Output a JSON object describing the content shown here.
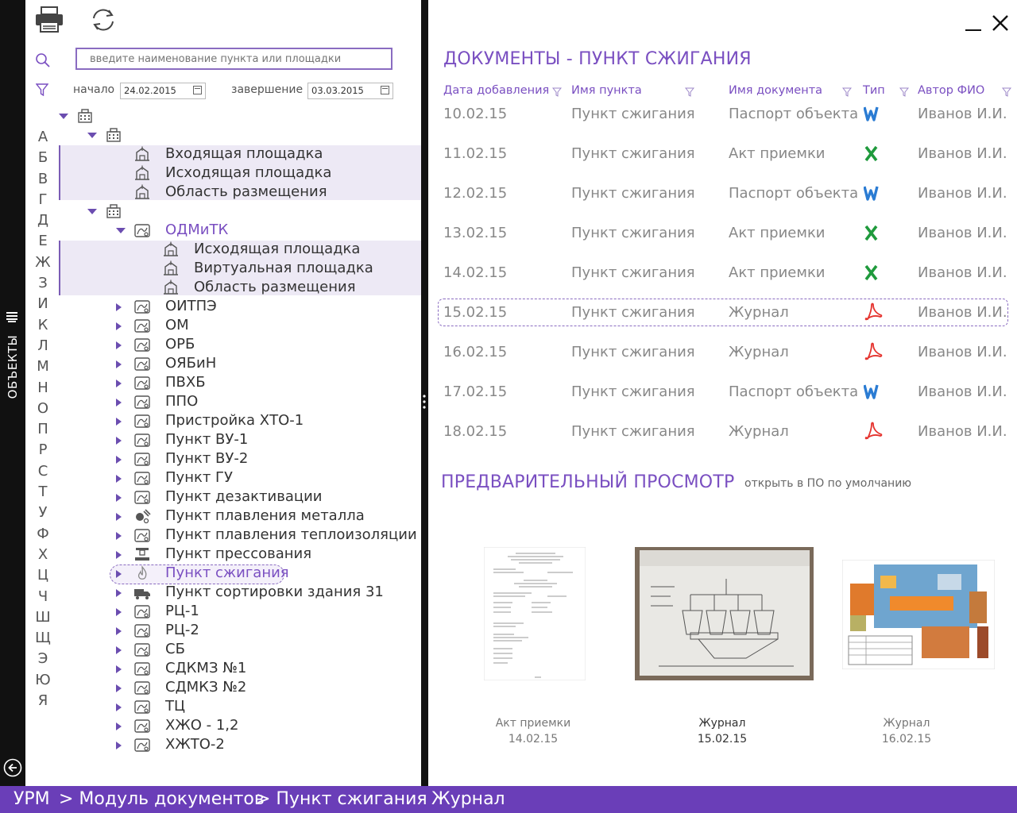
{
  "sidebar": {
    "label": "ОБЪЕКТЫ"
  },
  "search": {
    "placeholder": "введите наименование пункта или площадки"
  },
  "filter": {
    "start_label": "начало",
    "start_value": "24.02.2015",
    "end_label": "завершение",
    "end_value": "03.03.2015"
  },
  "alphabet": [
    "А",
    "Б",
    "В",
    "Г",
    "Д",
    "Е",
    "Ж",
    "З",
    "И",
    "К",
    "Л",
    "М",
    "Н",
    "О",
    "П",
    "Р",
    "С",
    "Т",
    "У",
    "Ф",
    "Х",
    "Ц",
    "Ч",
    "Ш",
    "Щ",
    "Э",
    "Ю",
    "Я"
  ],
  "tree": {
    "group1": [
      "Входящая площадка",
      "Исходящая площадка",
      "Область размещения"
    ],
    "odmitk": "ОДМиТК",
    "group2": [
      "Исходящая площадка",
      "Виртуальная площадка",
      "Область размещения"
    ],
    "items": [
      "ОИТПЭ",
      "ОМ",
      "ОРБ",
      "ОЯБиН",
      "ПВХБ",
      "ППО",
      "Пристройка ХТО-1",
      "Пункт ВУ-1",
      "Пункт ВУ-2",
      "Пункт ГУ",
      "Пункт дезактивации",
      "Пункт плавления металла",
      "Пункт плавления теплоизоляции",
      "Пункт прессования",
      "Пункт сжигания",
      "Пункт сортировки здания 31",
      "РЦ-1",
      "РЦ-2",
      "СБ",
      "СДКМЗ №1",
      "СДМКЗ №2",
      "ТЦ",
      "ХЖО - 1,2",
      "ХЖТО-2"
    ]
  },
  "documents": {
    "title": "ДОКУМЕНТЫ - ПУНКТ СЖИГАНИЯ",
    "columns": [
      "Дата добавления",
      "Имя пункта",
      "Имя документа",
      "Тип",
      "Автор ФИО"
    ],
    "rows": [
      {
        "date": "10.02.15",
        "point": "Пункт сжигания",
        "doc": "Паспорт объекта",
        "type": "word",
        "author": "Иванов И.И."
      },
      {
        "date": "11.02.15",
        "point": "Пункт сжигания",
        "doc": "Акт приемки",
        "type": "excel",
        "author": "Иванов И.И."
      },
      {
        "date": "12.02.15",
        "point": "Пункт сжигания",
        "doc": "Паспорт объекта",
        "type": "word",
        "author": "Иванов И.И."
      },
      {
        "date": "13.02.15",
        "point": "Пункт сжигания",
        "doc": "Акт приемки",
        "type": "excel",
        "author": "Иванов И.И."
      },
      {
        "date": "14.02.15",
        "point": "Пункт сжигания",
        "doc": "Акт приемки",
        "type": "excel",
        "author": "Иванов И.И."
      },
      {
        "date": "15.02.15",
        "point": "Пункт сжигания",
        "doc": "Журнал",
        "type": "pdf",
        "author": "Иванов И.И."
      },
      {
        "date": "16.02.15",
        "point": "Пункт сжигания",
        "doc": "Журнал",
        "type": "pdf",
        "author": "Иванов И.И."
      },
      {
        "date": "17.02.15",
        "point": "Пункт сжигания",
        "doc": "Паспорт объекта",
        "type": "word",
        "author": "Иванов И.И."
      },
      {
        "date": "18.02.15",
        "point": "Пункт сжигания",
        "doc": "Журнал",
        "type": "pdf",
        "author": "Иванов И.И."
      }
    ]
  },
  "preview": {
    "title": "ПРЕДВАРИТЕЛЬНЫЙ ПРОСМОТР",
    "open_link": "открыть в ПО по умолчанию",
    "items": [
      {
        "name": "Акт приемки",
        "date": "14.02.15"
      },
      {
        "name": "Журнал",
        "date": "15.02.15"
      },
      {
        "name": "Журнал",
        "date": "16.02.15"
      }
    ]
  },
  "status": {
    "home": "УРМ",
    "module": "> Модуль документов",
    "point": "> Пункт сжигания",
    "sep": "-",
    "doc": "Журнал"
  },
  "colors": {
    "accent": "#6a3eb8",
    "word": "#2b7cd3",
    "excel": "#1f9a3c",
    "pdf": "#e5322d"
  }
}
